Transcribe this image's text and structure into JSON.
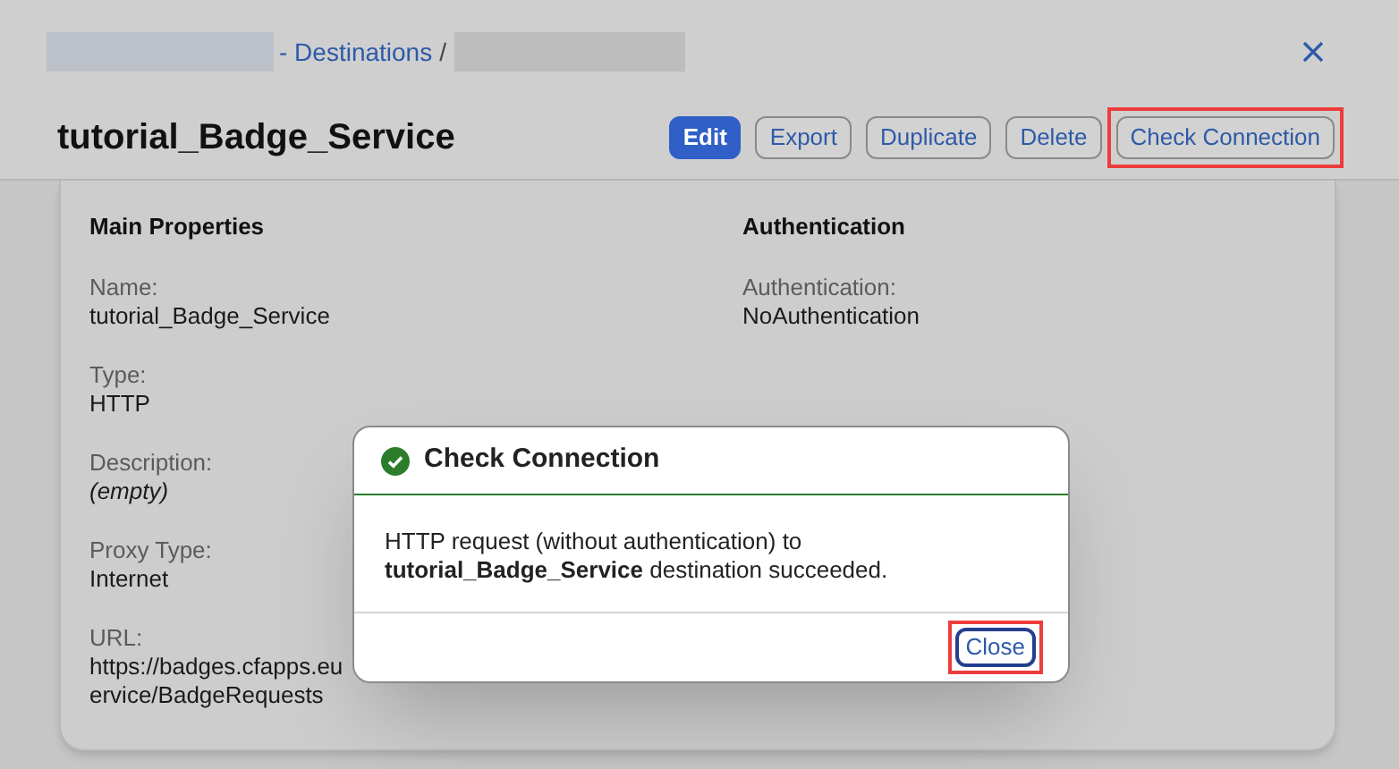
{
  "breadcrumb": {
    "link": "- Destinations",
    "separator": "/"
  },
  "title": "tutorial_Badge_Service",
  "actions": [
    {
      "label": "Edit",
      "kind": "primary",
      "highlighted": false
    },
    {
      "label": "Export",
      "kind": "default",
      "highlighted": false
    },
    {
      "label": "Duplicate",
      "kind": "default",
      "highlighted": false
    },
    {
      "label": "Delete",
      "kind": "default",
      "highlighted": false
    },
    {
      "label": "Check Connection",
      "kind": "default",
      "highlighted": true
    }
  ],
  "sections": [
    {
      "title": "Main Properties",
      "fields": [
        {
          "label": "Name:",
          "value": [
            "tutorial_Badge_Service"
          ],
          "italic": false
        },
        {
          "label": "Type:",
          "value": [
            "HTTP"
          ],
          "italic": false
        },
        {
          "label": "Description:",
          "value": [
            "(empty)"
          ],
          "italic": true
        },
        {
          "label": "Proxy Type:",
          "value": [
            "Internet"
          ],
          "italic": false
        },
        {
          "label": "URL:",
          "value": [
            "https://badges.cfapps.eu",
            "ervice/BadgeRequests"
          ],
          "italic": false
        }
      ]
    },
    {
      "title": "Authentication",
      "fields": [
        {
          "label": "Authentication:",
          "value": [
            "NoAuthentication"
          ],
          "italic": false
        }
      ]
    }
  ],
  "dialog": {
    "title": "Check Connection",
    "message": "HTTP request (without authentication) to **tutorial_Badge_Service** destination succeeded.",
    "button": {
      "label": "Close",
      "highlighted": true
    }
  }
}
